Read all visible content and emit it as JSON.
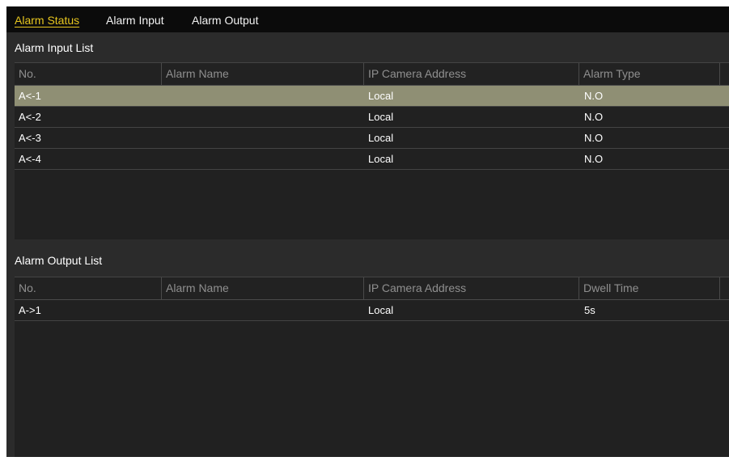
{
  "tabs": [
    {
      "label": "Alarm Status",
      "active": true
    },
    {
      "label": "Alarm Input",
      "active": false
    },
    {
      "label": "Alarm Output",
      "active": false
    }
  ],
  "alarm_input_list": {
    "title": "Alarm Input List",
    "columns": [
      "No.",
      "Alarm Name",
      "IP Camera Address",
      "Alarm Type"
    ],
    "rows": [
      {
        "no": "A<-1",
        "name": "",
        "ip": "Local",
        "type": "N.O",
        "selected": true
      },
      {
        "no": "A<-2",
        "name": "",
        "ip": "Local",
        "type": "N.O",
        "selected": false
      },
      {
        "no": "A<-3",
        "name": "",
        "ip": "Local",
        "type": "N.O",
        "selected": false
      },
      {
        "no": "A<-4",
        "name": "",
        "ip": "Local",
        "type": "N.O",
        "selected": false
      }
    ]
  },
  "alarm_output_list": {
    "title": "Alarm Output List",
    "columns": [
      "No.",
      "Alarm Name",
      "IP Camera Address",
      "Dwell Time"
    ],
    "rows": [
      {
        "no": "A->1",
        "name": "",
        "ip": "Local",
        "dwell": "5s",
        "selected": false
      }
    ]
  },
  "colors": {
    "active_tab": "#e6c51f",
    "selected_row": "#8f8f74",
    "panel_bg": "#2b2b2b"
  }
}
